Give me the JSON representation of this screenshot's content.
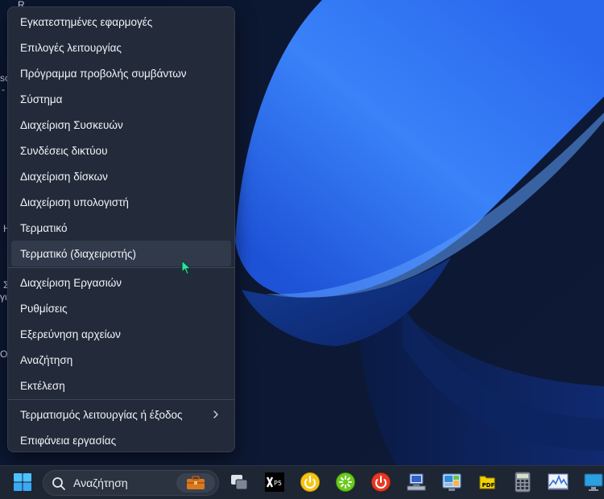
{
  "start_menu": {
    "items": [
      {
        "label": "Εγκατεστημένες εφαρμογές"
      },
      {
        "label": "Επιλογές λειτουργίας"
      },
      {
        "label": "Πρόγραμμα προβολής συμβάντων"
      },
      {
        "label": "Σύστημα"
      },
      {
        "label": "Διαχείριση Συσκευών"
      },
      {
        "label": "Συνδέσεις δικτύου"
      },
      {
        "label": "Διαχείριση δίσκων"
      },
      {
        "label": "Διαχείριση υπολογιστή"
      },
      {
        "label": "Τερματικό"
      },
      {
        "label": "Τερματικό (διαχειριστής)"
      },
      {
        "label": "Διαχείριση Εργασιών"
      },
      {
        "label": "Ρυθμίσεις"
      },
      {
        "label": "Εξερεύνηση αρχείων"
      },
      {
        "label": "Αναζήτηση"
      },
      {
        "label": "Εκτέλεση"
      },
      {
        "label": "Τερματισμός λειτουργίας ή έξοδος"
      },
      {
        "label": "Επιφάνεια εργασίας"
      }
    ],
    "hovered_index": 9
  },
  "taskbar": {
    "search_placeholder": "Αναζήτηση",
    "icons": [
      "windows-start-icon",
      "search-icon",
      "briefcase-icon",
      "task-view-icon",
      "xp5-app-icon",
      "yellow-power-icon",
      "green-app-icon",
      "red-power-icon",
      "network-monitor-icon",
      "remote-desktop-icon",
      "pdf-icon",
      "calculator-icon",
      "performance-monitor-icon",
      "display-icon"
    ]
  },
  "desktop_fragments": [
    "R",
    "sc",
    "-",
    "Η",
    "Σ",
    "γι",
    "Ο"
  ],
  "colors": {
    "menu_bg": "#232b3a",
    "menu_hover": "#313a4a",
    "taskbar_bg": "#1e2533",
    "cursor": "#2ee0a0",
    "wallpaper_blue": "#2f6df0"
  }
}
